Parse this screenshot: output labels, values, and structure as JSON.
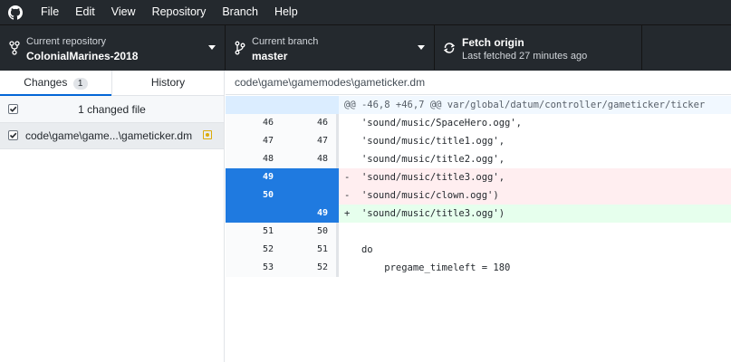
{
  "menubar": {
    "items": [
      "File",
      "Edit",
      "View",
      "Repository",
      "Branch",
      "Help"
    ]
  },
  "toolbar": {
    "repository": {
      "title": "Current repository",
      "value": "ColonialMarines-2018"
    },
    "branch": {
      "title": "Current branch",
      "value": "master"
    },
    "fetch": {
      "title": "Fetch origin",
      "value": "Last fetched 27 minutes ago"
    }
  },
  "sidebar": {
    "tabs": {
      "changes": "Changes",
      "changes_count": "1",
      "history": "History"
    },
    "changed_header": "1 changed file",
    "files": [
      {
        "path": "code\\game\\game...\\gameticker.dm",
        "status": "modified"
      }
    ]
  },
  "diff": {
    "file_path": "code\\game\\gamemodes\\gameticker.dm",
    "hunk": "@@ -46,8 +46,7 @@ var/global/datum/controller/gameticker/ticker",
    "lines": [
      {
        "type": "context",
        "old": "46",
        "new": "46",
        "marker": " ",
        "text": "  'sound/music/SpaceHero.ogg',"
      },
      {
        "type": "context",
        "old": "47",
        "new": "47",
        "marker": " ",
        "text": "  'sound/music/title1.ogg',"
      },
      {
        "type": "context",
        "old": "48",
        "new": "48",
        "marker": " ",
        "text": "  'sound/music/title2.ogg',"
      },
      {
        "type": "del",
        "old": "49",
        "new": "",
        "marker": "-",
        "text": "  'sound/music/title3.ogg',"
      },
      {
        "type": "del",
        "old": "50",
        "new": "",
        "marker": "-",
        "text": "  'sound/music/clown.ogg')"
      },
      {
        "type": "add",
        "old": "",
        "new": "49",
        "marker": "+",
        "text": "  'sound/music/title3.ogg')"
      },
      {
        "type": "context",
        "old": "51",
        "new": "50",
        "marker": " ",
        "text": ""
      },
      {
        "type": "context",
        "old": "52",
        "new": "51",
        "marker": " ",
        "text": "  do"
      },
      {
        "type": "context",
        "old": "53",
        "new": "52",
        "marker": " ",
        "text": "      pregame_timeleft = 180"
      }
    ]
  },
  "colors": {
    "toolbar_bg": "#24292e",
    "selection_blue": "#1f7ae0",
    "deleted_bg": "#ffeef0",
    "added_bg": "#e6ffed",
    "modified_icon": "#dbab09"
  }
}
